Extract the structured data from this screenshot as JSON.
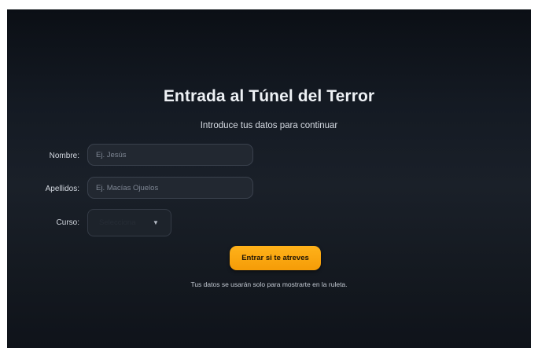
{
  "form": {
    "title": "Entrada al Túnel del Terror",
    "subtitle": "Introduce tus datos para continuar",
    "fields": {
      "nombre": {
        "label": "Nombre:",
        "placeholder": "Ej. Jesús",
        "value": ""
      },
      "apellidos": {
        "label": "Apellidos:",
        "placeholder": "Ej. Macías Ojuelos",
        "value": ""
      },
      "curso": {
        "label": "Curso:",
        "selected": "Selecciona"
      }
    },
    "submit_label": "Entrar si te atreves",
    "note": "Tus datos se usarán solo para mostrarte en la ruleta."
  },
  "icons": {
    "select_chevron": "chevron-down-icon"
  },
  "colors": {
    "background": "#161c24",
    "accent": "#f7a10d",
    "field_background": "#222831",
    "text": "#eef1f5"
  }
}
